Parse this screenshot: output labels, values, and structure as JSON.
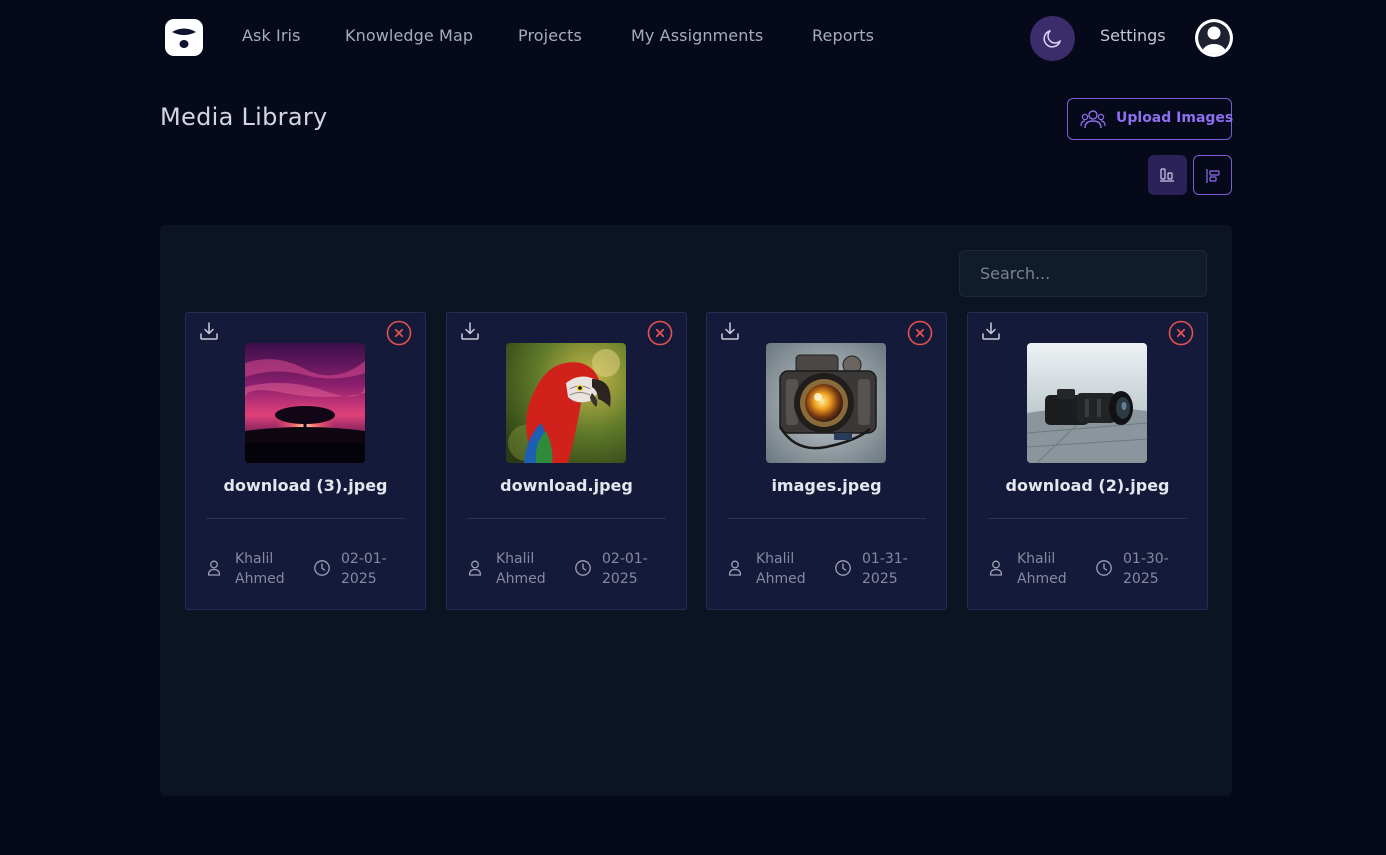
{
  "nav": {
    "links": [
      "Ask Iris",
      "Knowledge Map",
      "Projects",
      "My Assignments",
      "Reports"
    ],
    "settings": "Settings",
    "theme_icon": "moon-icon",
    "avatar_icon": "user-avatar-icon"
  },
  "page": {
    "title": "Media Library",
    "upload_label": "Upload Images"
  },
  "search": {
    "placeholder": "Search..."
  },
  "files": [
    {
      "name": "download (3).jpeg",
      "owner_first": "Khalil",
      "owner_last": "Ahmed",
      "date_a": "02-01-",
      "date_b": "2025",
      "thumb": "sunset-tree"
    },
    {
      "name": "download.jpeg",
      "owner_first": "Khalil",
      "owner_last": "Ahmed",
      "date_a": "02-01-",
      "date_b": "2025",
      "thumb": "red-parrot"
    },
    {
      "name": "images.jpeg",
      "owner_first": "Khalil",
      "owner_last": "Ahmed",
      "date_a": "01-31-",
      "date_b": "2025",
      "thumb": "vintage-camera"
    },
    {
      "name": "download (2).jpeg",
      "owner_first": "Khalil",
      "owner_last": "Ahmed",
      "date_a": "01-30-",
      "date_b": "2025",
      "thumb": "dslr-camera"
    }
  ],
  "colors": {
    "background": "#060919",
    "panel": "#0c1424",
    "card": "#161a3a",
    "accent": "#7d5cd6",
    "delete": "#e0524f"
  }
}
